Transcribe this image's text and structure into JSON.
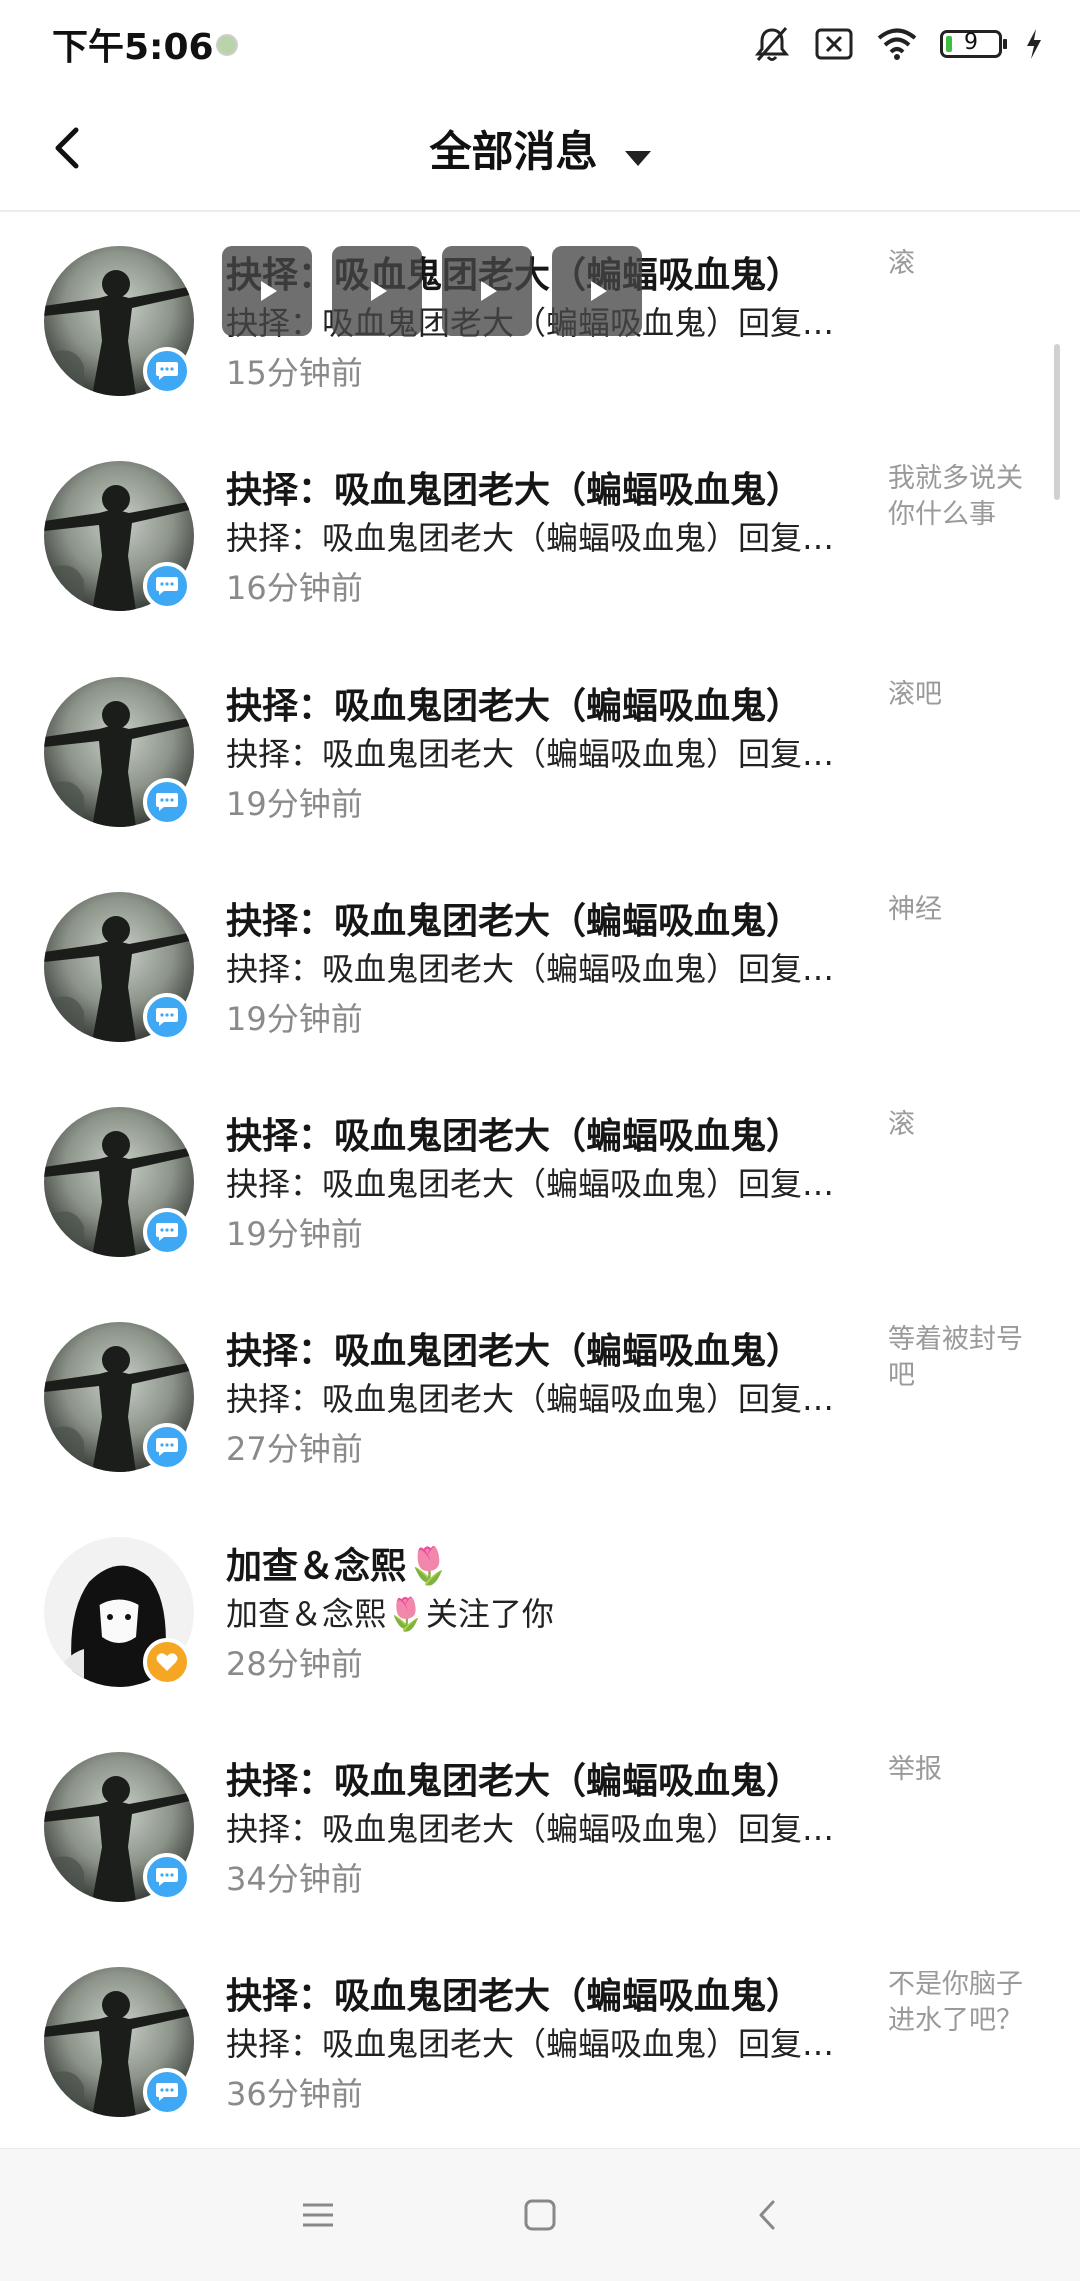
{
  "status_bar": {
    "time": "下午5:06",
    "battery_level": "9",
    "icons": [
      "silent-icon",
      "sim-off-icon",
      "wifi-icon",
      "battery-icon",
      "charging-icon"
    ]
  },
  "header": {
    "title": "全部消息",
    "back_icon": "back-arrow-icon",
    "dropdown_icon": "caret-down-icon"
  },
  "messages": [
    {
      "name": "抉择：吸血鬼团老大（蝙蝠吸血鬼）",
      "desc": "抉择：吸血鬼团老大（蝙蝠吸血鬼）回复了你的评论",
      "time": "15分钟前",
      "preview": "滚",
      "badge": "comment"
    },
    {
      "name": "抉择：吸血鬼团老大（蝙蝠吸血鬼）",
      "desc": "抉择：吸血鬼团老大（蝙蝠吸血鬼）回复了你的评论",
      "time": "16分钟前",
      "preview": "我就多说关你什么事",
      "badge": "comment"
    },
    {
      "name": "抉择：吸血鬼团老大（蝙蝠吸血鬼）",
      "desc": "抉择：吸血鬼团老大（蝙蝠吸血鬼）回复了你的评论",
      "time": "19分钟前",
      "preview": "滚吧",
      "badge": "comment"
    },
    {
      "name": "抉择：吸血鬼团老大（蝙蝠吸血鬼）",
      "desc": "抉择：吸血鬼团老大（蝙蝠吸血鬼）回复了你的评论",
      "time": "19分钟前",
      "preview": "神经",
      "badge": "comment"
    },
    {
      "name": "抉择：吸血鬼团老大（蝙蝠吸血鬼）",
      "desc": "抉择：吸血鬼团老大（蝙蝠吸血鬼）回复了你的评论",
      "time": "19分钟前",
      "preview": "滚",
      "badge": "comment"
    },
    {
      "name": "抉择：吸血鬼团老大（蝙蝠吸血鬼）",
      "desc": "抉择：吸血鬼团老大（蝙蝠吸血鬼）回复了你的评论",
      "time": "27分钟前",
      "preview": "等着被封号吧",
      "badge": "comment"
    },
    {
      "name": "加查＆念熙🌷",
      "desc": "加查＆念熙🌷关注了你",
      "time": "28分钟前",
      "preview": "",
      "badge": "follow"
    },
    {
      "name": "抉择：吸血鬼团老大（蝙蝠吸血鬼）",
      "desc": "抉择：吸血鬼团老大（蝙蝠吸血鬼）回复了你的评论",
      "time": "34分钟前",
      "preview": "举报",
      "badge": "comment"
    },
    {
      "name": "抉择：吸血鬼团老大（蝙蝠吸血鬼）",
      "desc": "抉择：吸血鬼团老大（蝙蝠吸血鬼）回复了你的评论",
      "time": "36分钟前",
      "preview": "不是你脑子进水了吧？",
      "badge": "comment"
    }
  ],
  "nav_bar": {
    "icons": [
      "menu-icon",
      "home-square-icon",
      "back-chevron-icon"
    ]
  },
  "colors": {
    "comment_badge": "#3ea8f5",
    "follow_badge": "#f5a623",
    "secondary_text": "#8a8a8a"
  }
}
